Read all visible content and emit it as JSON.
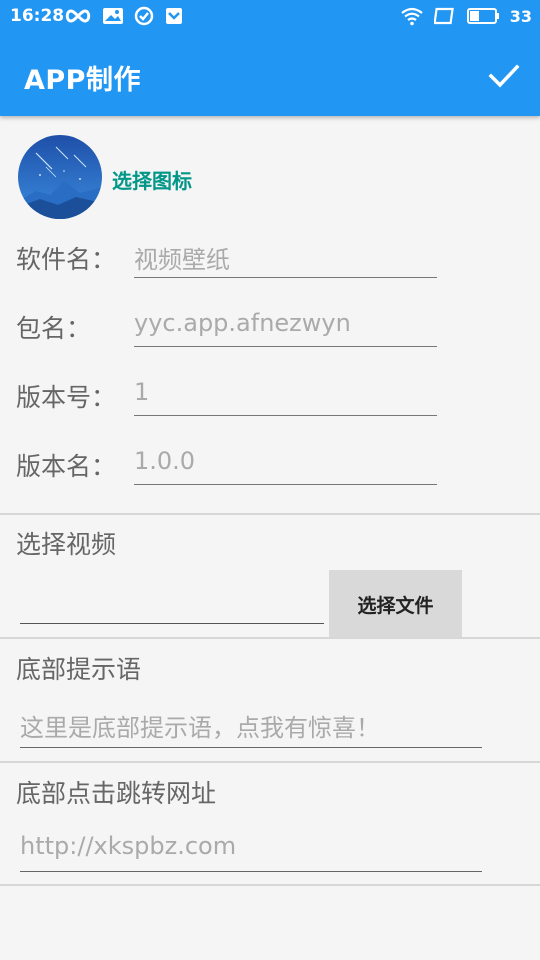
{
  "status_bar": {
    "time": "16:28",
    "battery": "33"
  },
  "app_bar": {
    "title": "APP制作"
  },
  "icon": {
    "choose_label": "选择图标"
  },
  "form": {
    "app_name": {
      "label": "软件名：",
      "value": "视频壁纸"
    },
    "package_name": {
      "label": "包名：",
      "value": "yyc.app.afnezwyn"
    },
    "version_code": {
      "label": "版本号：",
      "value": "1"
    },
    "version_name": {
      "label": "版本名：",
      "value": "1.0.0"
    }
  },
  "video": {
    "label": "选择视频",
    "path_value": "",
    "choose_button": "选择文件"
  },
  "footer_tip": {
    "label": "底部提示语",
    "value": "这里是底部提示语，点我有惊喜！"
  },
  "footer_url": {
    "label": "底部点击跳转网址",
    "value": "http://xkspbz.com"
  },
  "colors": {
    "app_bar": "#2196f3",
    "accent": "#009688",
    "background": "#f5f5f5"
  }
}
